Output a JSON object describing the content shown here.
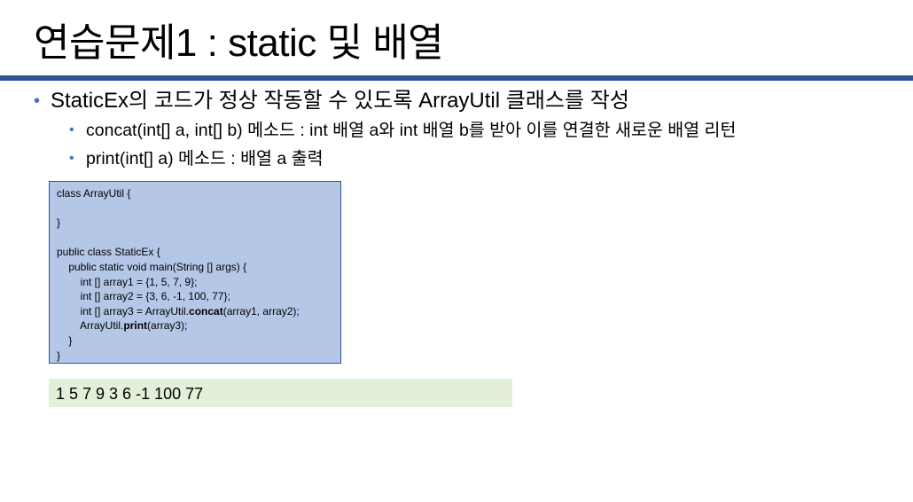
{
  "title": "연습문제1 : static 및 배열",
  "bullets": {
    "main": "StaticEx의 코드가 정상 작동할 수 있도록 ArrayUtil 클래스를 작성",
    "sub": [
      "concat(int[] a, int[] b) 메소드 : int 배열 a와 int 배열 b를 받아 이를 연결한 새로운 배열 리턴",
      "print(int[] a) 메소드 : 배열 a 출력"
    ]
  },
  "code": {
    "line1": "class ArrayUtil {",
    "line2": "",
    "line3": "}",
    "line4": "",
    "line5": "public class StaticEx {",
    "line6": "    public static void main(String [] args) {",
    "line7": "        int [] array1 = {1, 5, 7, 9};",
    "line8": "        int [] array2 = {3, 6, -1, 100, 77};",
    "line9_pre": "        int [] array3 = ArrayUtil.",
    "line9_bold": "concat",
    "line9_post": "(array1, array2);",
    "line10_pre": "        ArrayUtil.",
    "line10_bold": "print",
    "line10_post": "(array3);",
    "line11": "    }",
    "line12": "}"
  },
  "output": "1 5 7 9 3 6 -1 100 77",
  "colors": {
    "rule": "#2f5597",
    "bullet": "#4472c4",
    "code_bg": "#b4c7e7",
    "output_bg": "#e2efd9"
  }
}
